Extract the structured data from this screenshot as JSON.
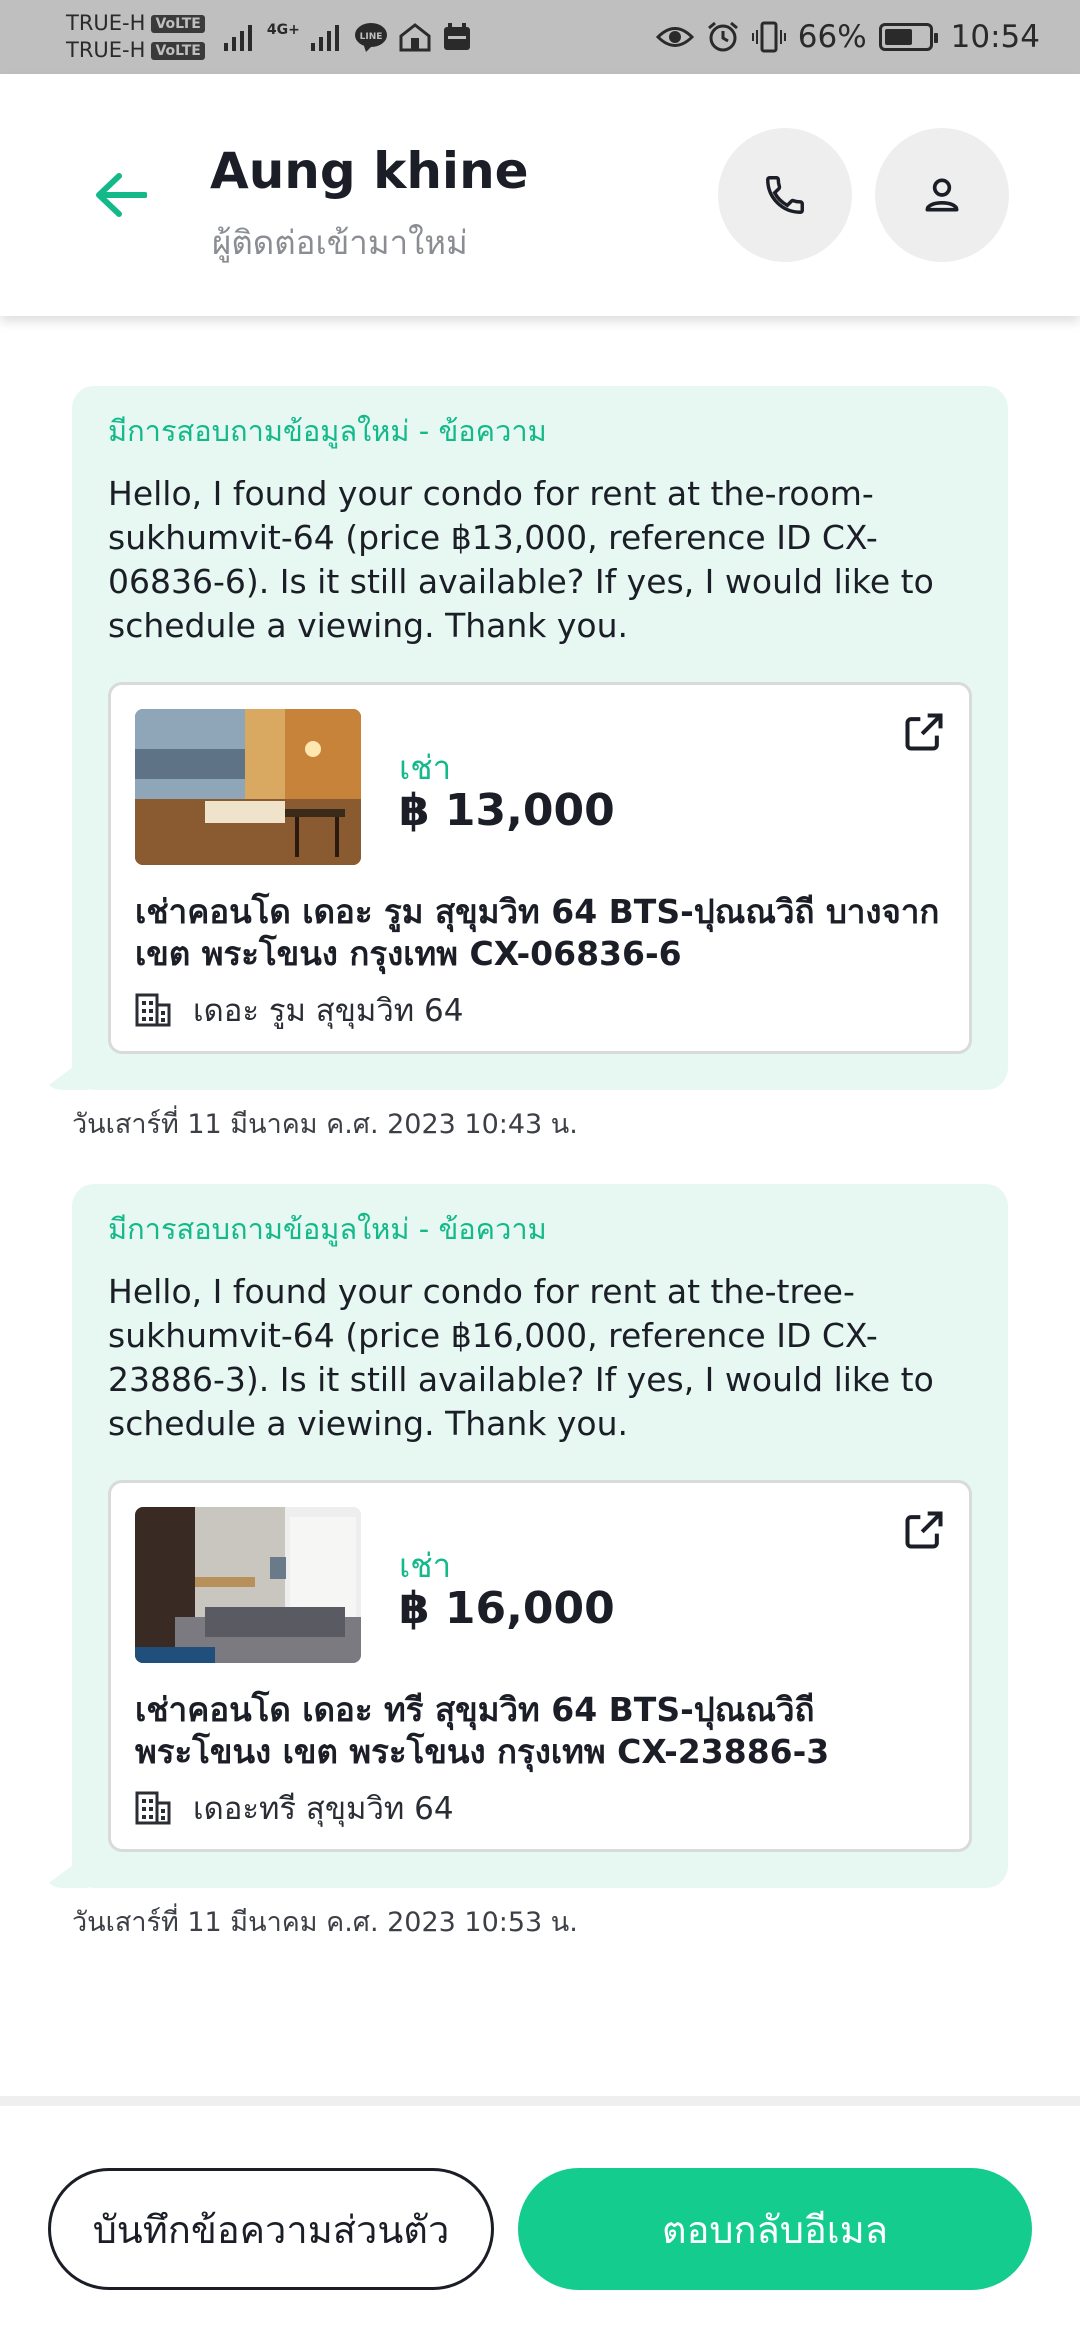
{
  "status_bar": {
    "carrier_1": "TRUE-H",
    "carrier_2": "TRUE-H",
    "volte": "VoLTE",
    "network": "4G+",
    "battery": "66%",
    "battery_level": 0.66,
    "time": "10:54"
  },
  "header": {
    "contact_name": "Aung khine",
    "contact_status": "ผู้ติดต่อเข้ามาใหม่"
  },
  "messages": [
    {
      "title": "มีการสอบถามข้อมูลใหม่ - ข้อความ",
      "body": "Hello, I found your condo for rent at the-room-sukhumvit-64 (price ฿13,000, reference ID CX-06836-6). Is it still available? If yes, I would like to schedule a viewing. Thank you.",
      "listing": {
        "type": "เช่า",
        "price": "฿ 13,000",
        "title": "เช่าคอนโด  เดอะ รูม สุขุมวิท 64 BTS-ปุณณวิถี บางจาก เขต พระโขนง กรุงเทพ CX-06836-6",
        "project": "เดอะ รูม สุขุมวิท 64"
      },
      "timestamp": "วันเสาร์ที่ 11 มีนาคม ค.ศ. 2023 10:43 น."
    },
    {
      "title": "มีการสอบถามข้อมูลใหม่ - ข้อความ",
      "body": "Hello, I found your condo for rent at the-tree-sukhumvit-64 (price ฿16,000, reference ID CX-23886-3). Is it still available? If yes, I would like to schedule a viewing. Thank you.",
      "listing": {
        "type": "เช่า",
        "price": "฿ 16,000",
        "title": "เช่าคอนโด  เดอะ ทรี สุขุมวิท 64 BTS-ปุณณวิถี พระโขนง เขต พระโขนง กรุงเทพ CX-23886-3",
        "project": "เดอะทรี สุขุมวิท 64"
      },
      "timestamp": "วันเสาร์ที่ 11 มีนาคม ค.ศ. 2023 10:53 น."
    }
  ],
  "actions": {
    "private_note": "บันทึกข้อความส่วนตัว",
    "reply_email": "ตอบกลับอีเมล"
  },
  "colors": {
    "accent": "#13cc8d",
    "accent_text": "#14b98a",
    "bubble_bg": "#e6f8f1"
  }
}
